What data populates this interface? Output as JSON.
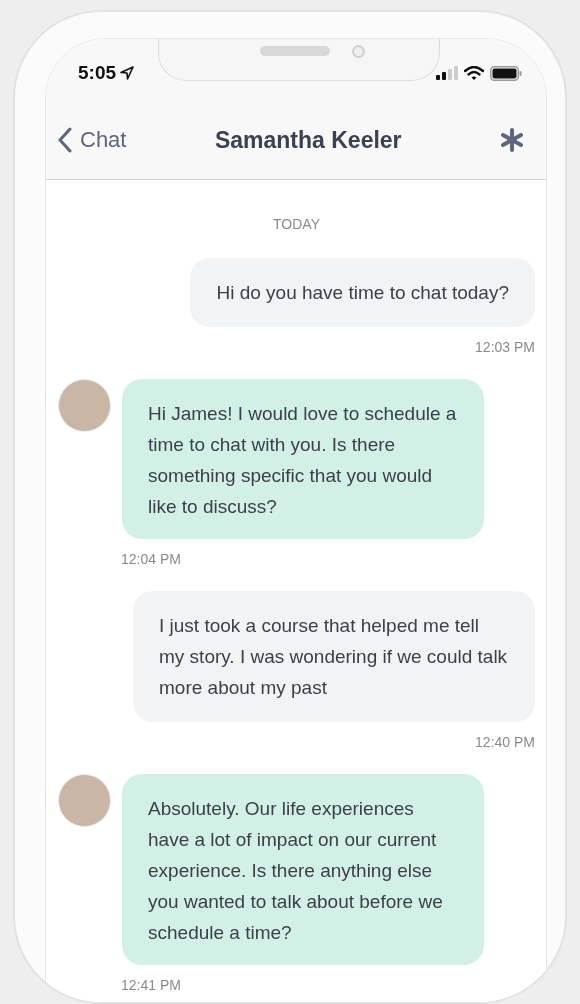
{
  "status_bar": {
    "time": "5:05"
  },
  "header": {
    "back_label": "Chat",
    "title": "Samantha Keeler"
  },
  "date_divider": "TODAY",
  "messages": [
    {
      "kind": "sent",
      "text": "Hi do you have time to chat today?",
      "time": "12:03 PM"
    },
    {
      "kind": "received",
      "text": "Hi James! I would love to schedule a time to chat with you. Is there something specific that you would like to discuss?",
      "time": "12:04 PM"
    },
    {
      "kind": "sent",
      "text": "I just took a course that helped me tell my story. I was wondering if we could talk more about my past",
      "time": "12:40 PM"
    },
    {
      "kind": "received",
      "text": "Absolutely. Our life experiences have a lot of impact on our current experience. Is there anything else you wanted to talk about before we schedule a time?",
      "time": "12:41 PM"
    }
  ]
}
